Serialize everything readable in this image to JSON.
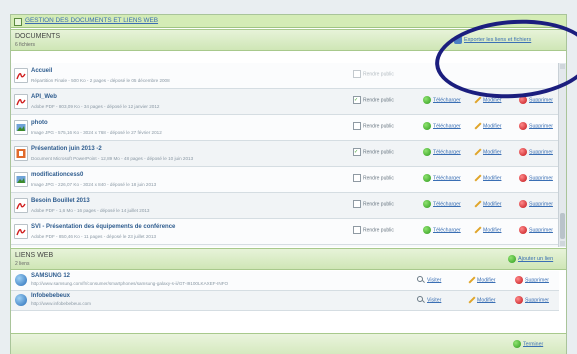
{
  "main_title": "GESTION DES DOCUMENTS ET LIENS WEB",
  "documents": {
    "title": "DOCUMENTS",
    "count": "6 fichiers",
    "header_action": "Exporter les liens et fichiers",
    "rows": [
      {
        "icon": "pdf-icon",
        "name": "Accueil",
        "desc": "Répartition Finale - 500 Ko - 2 pages - déposé le 05 décembre 2008",
        "public_label": "Rendre public",
        "public_dim": true,
        "actions": []
      },
      {
        "icon": "pdf-icon",
        "name": "API_Web",
        "desc": "Adobe PDF - 803,09 Ko - 34 pages - déposé le 12 janvier 2012",
        "public_label": "Rendre public",
        "public_dim": false,
        "checked": true,
        "actions": [
          "Télécharger",
          "Modifier",
          "Supprimer"
        ]
      },
      {
        "icon": "image-icon",
        "name": "photo",
        "desc": "Image JPG - 575,16 Ko - 3024 x 768 - déposé le 27 février 2012",
        "public_label": "Rendre public",
        "public_dim": false,
        "actions": [
          "Télécharger",
          "Modifier",
          "Supprimer"
        ]
      },
      {
        "icon": "ppt-icon",
        "name": "Présentation juin 2013 -2",
        "desc": "Document Microsoft PowerPoint - 12,89 Mo - 48 pages - déposé le 10 juin 2013",
        "public_label": "Rendre public",
        "public_dim": false,
        "checked": true,
        "actions": [
          "Télécharger",
          "Modifier",
          "Supprimer"
        ]
      },
      {
        "icon": "image-icon",
        "name": "modificationcess0",
        "desc": "Image JPG - 226,07 Ko - 3024 x 840 - déposé le 18 juin 2013",
        "public_label": "Rendre public",
        "public_dim": false,
        "actions": [
          "Télécharger",
          "Modifier",
          "Supprimer"
        ]
      },
      {
        "icon": "pdf-icon",
        "name": "Besoin Bouillet 2013",
        "desc": "Adobe PDF - 1,6 Mo - 16 pages - déposé le 14 juillet 2013",
        "public_label": "Rendre public",
        "public_dim": false,
        "actions": [
          "Télécharger",
          "Modifier",
          "Supprimer"
        ]
      },
      {
        "icon": "pdf-icon",
        "name": "SVI - Présentation des équipements de conférence",
        "desc": "Adobe PDF - 850,46 Ko - 11 pages - déposé le 23 juillet 2013",
        "public_label": "Rendre public",
        "public_dim": false,
        "actions": [
          "Télécharger",
          "Modifier",
          "Supprimer"
        ]
      }
    ]
  },
  "liens": {
    "title": "LIENS WEB",
    "count": "2 liens",
    "header_action": "Ajouter un lien",
    "rows": [
      {
        "name": "SAMSUNG 12",
        "desc": "http://www.samsung.com/fr/consumer/smartphones/samsung-galaxy-s-ii/GT-I9100LKAXEF-INFO",
        "actions": [
          "Visiter",
          "Modifier",
          "Supprimer"
        ]
      },
      {
        "name": "Infobebebeux",
        "desc": "http://www.infobebebeux.com",
        "actions": [
          "Visiter",
          "Modifier",
          "Supprimer"
        ]
      }
    ]
  },
  "footer_action": "Terminer",
  "colors": {
    "accent_green": "#2f9a1e",
    "link_blue": "#3a6fb4",
    "delete_red": "#c2141a",
    "annotation": "#1b1e7e"
  }
}
